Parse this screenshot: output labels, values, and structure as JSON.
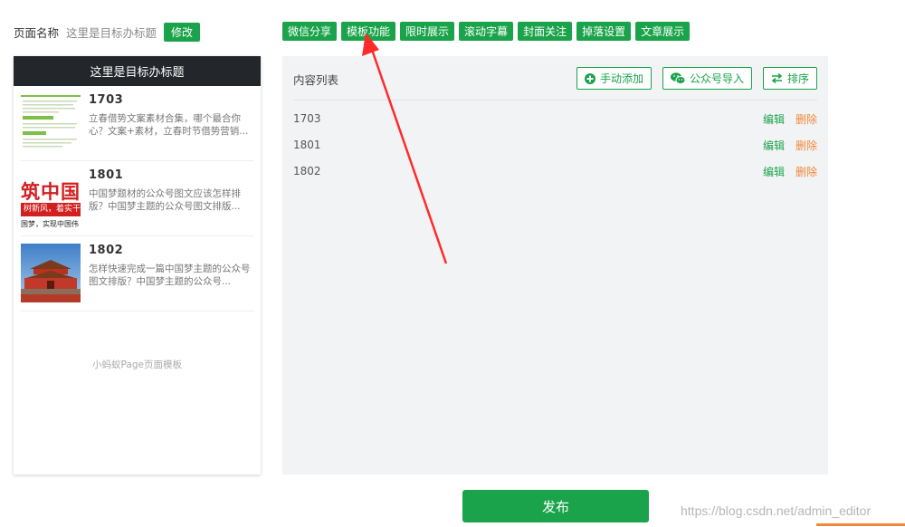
{
  "page_name": {
    "label": "页面名称",
    "value": "这里是目标办标题",
    "modify_label": "修改"
  },
  "toolbar": {
    "buttons": [
      "微信分享",
      "模板功能",
      "限时展示",
      "滚动字幕",
      "封面关注",
      "掉落设置",
      "文章展示"
    ]
  },
  "phone": {
    "header_title": "这里是目标办标题",
    "articles": [
      {
        "title": "1703",
        "desc": "立春借势文案素材合集，哪个最合你心？文案+素材，立春时节借势营销..."
      },
      {
        "title": "1801",
        "desc": "中国梦题材的公众号图文应该怎样排版？中国梦主题的公众号图文排版..."
      },
      {
        "title": "1802",
        "desc": "怎样快速完成一篇中国梦主题的公众号图文排版？中国梦主题的公众号..."
      }
    ],
    "thumb2_text": {
      "main": "筑中国",
      "banner": "树新风，着实干，",
      "sub": "国梦，实现中国伟"
    },
    "footer_note": "小蚂蚁Page页面模板"
  },
  "content_panel": {
    "title": "内容列表",
    "actions": {
      "manual_add": "手动添加",
      "import": "公众号导入",
      "sort": "排序"
    },
    "rows": [
      {
        "name": "1703",
        "edit": "编辑",
        "delete": "删除"
      },
      {
        "name": "1801",
        "edit": "编辑",
        "delete": "删除"
      },
      {
        "name": "1802",
        "edit": "编辑",
        "delete": "删除"
      }
    ]
  },
  "publish_label": "发布",
  "watermark": "https://blog.csdn.net/admin_editor",
  "colors": {
    "accent": "#1aa34a",
    "delete": "#f0883b",
    "header_bg": "#23262a",
    "panel_bg": "#f2f3f5",
    "annotation": "#ff2b2b"
  }
}
